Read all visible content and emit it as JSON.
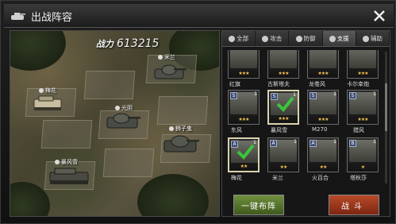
{
  "window": {
    "title": "出战阵容"
  },
  "battlefield": {
    "power_label": "战力",
    "power_value": "613215",
    "units": [
      {
        "name": "梅花"
      },
      {
        "name": "米兰"
      },
      {
        "name": "光阴"
      },
      {
        "name": "狮子鬼"
      },
      {
        "name": "暴风雪"
      }
    ]
  },
  "tabs": [
    {
      "label": "全部",
      "icon": "person-icon"
    },
    {
      "label": "攻击",
      "icon": "attack-icon"
    },
    {
      "label": "防御",
      "icon": "shield-icon"
    },
    {
      "label": "支援",
      "icon": "support-icon",
      "active": true
    },
    {
      "label": "辅助",
      "icon": "assist-icon"
    }
  ],
  "roster": [
    {
      "name": "红旗",
      "stars": "★★★",
      "level": ""
    },
    {
      "name": "古斯塔夫",
      "stars": "★★★",
      "level": ""
    },
    {
      "name": "龙卷风",
      "stars": "★★★",
      "level": ""
    },
    {
      "name": "卡尔幸炮",
      "stars": "★★★",
      "level": ""
    },
    {
      "name": "东风",
      "stars": "★★★",
      "level": "1"
    },
    {
      "name": "暴风雪",
      "stars": "★★★",
      "level": "1"
    },
    {
      "name": "M270",
      "stars": "★★★",
      "level": "1"
    },
    {
      "name": "猎风",
      "stars": "★★★",
      "level": "1"
    },
    {
      "name": "梅花",
      "stars": "★★",
      "level": "1"
    },
    {
      "name": "米兰",
      "stars": "★★",
      "level": "1"
    },
    {
      "name": "火百合",
      "stars": "★★",
      "level": "1"
    },
    {
      "name": "塔秋莎",
      "stars": "★",
      "level": "1"
    }
  ],
  "buttons": {
    "auto_deploy": "一键布阵",
    "battle": "战斗"
  },
  "colors": {
    "accent_green": "#6f8f3e",
    "accent_red": "#b84a2a",
    "check_green": "#3cc43c",
    "star": "#f2c14e"
  }
}
